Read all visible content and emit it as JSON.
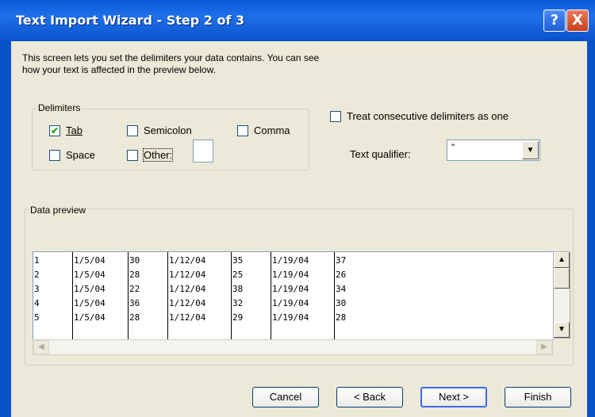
{
  "window": {
    "title": "Text Import Wizard - Step 2 of 3",
    "help_label": "?",
    "close_label": "X"
  },
  "description": [
    "This screen lets you set the delimiters your data contains.  You can see",
    "how your text is affected in the preview below."
  ],
  "delimiters": {
    "legend": "Delimiters",
    "tab": {
      "label": "Tab",
      "checked": true
    },
    "semicolon": {
      "label": "Semicolon",
      "checked": false
    },
    "comma": {
      "label": "Comma",
      "checked": false
    },
    "space": {
      "label": "Space",
      "checked": false
    },
    "other": {
      "label": "Other:",
      "checked": false,
      "value": ""
    }
  },
  "treat_consecutive": {
    "label": "Treat consecutive delimiters as one",
    "checked": false
  },
  "text_qualifier": {
    "label": "Text qualifier:",
    "value": "\""
  },
  "preview": {
    "legend": "Data preview",
    "rows": [
      [
        "1",
        "1/5/04",
        "30",
        "1/12/04",
        "35",
        "1/19/04",
        "37"
      ],
      [
        "2",
        "1/5/04",
        "28",
        "1/12/04",
        "25",
        "1/19/04",
        "26"
      ],
      [
        "3",
        "1/5/04",
        "22",
        "1/12/04",
        "38",
        "1/19/04",
        "34"
      ],
      [
        "4",
        "1/5/04",
        "36",
        "1/12/04",
        "32",
        "1/19/04",
        "30"
      ],
      [
        "5",
        "1/5/04",
        "28",
        "1/12/04",
        "29",
        "1/19/04",
        "28"
      ]
    ]
  },
  "buttons": {
    "cancel": "Cancel",
    "back": "< Back",
    "next": "Next >",
    "finish": "Finish"
  },
  "icons": {
    "check": "check-icon",
    "dropdown": "chevron-down-icon",
    "up": "arrow-up-icon",
    "down": "arrow-down-icon",
    "left": "arrow-left-icon",
    "right": "arrow-right-icon"
  }
}
